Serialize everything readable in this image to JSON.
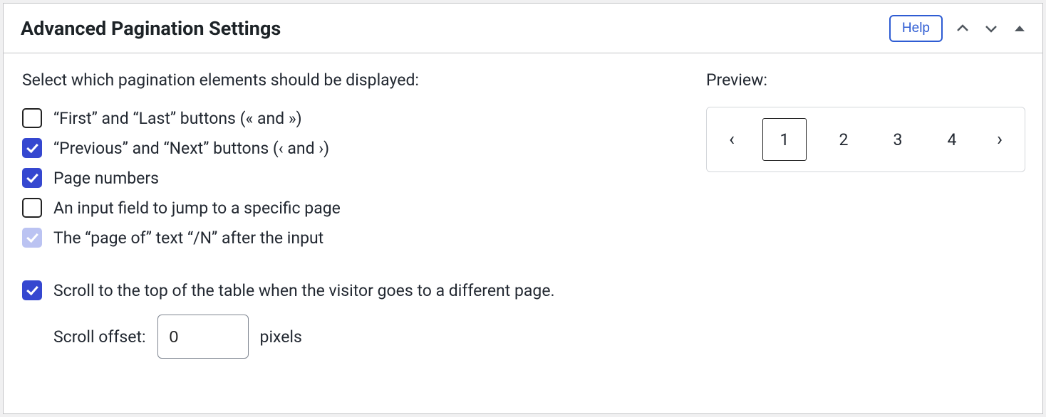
{
  "header": {
    "title": "Advanced Pagination Settings",
    "help_label": "Help"
  },
  "intro": "Select which pagination elements should be displayed:",
  "options": [
    {
      "label": "“First” and “Last” buttons (« and »)",
      "checked": false,
      "disabled": false
    },
    {
      "label": "“Previous” and “Next” buttons (‹ and ›)",
      "checked": true,
      "disabled": false
    },
    {
      "label": "Page numbers",
      "checked": true,
      "disabled": false
    },
    {
      "label": "An input field to jump to a specific page",
      "checked": false,
      "disabled": false
    },
    {
      "label": "The “page of” text “/N” after the input",
      "checked": true,
      "disabled": true
    }
  ],
  "scroll_option": {
    "label": "Scroll to the top of the table when the visitor goes to a different page.",
    "checked": true
  },
  "scroll_offset": {
    "label": "Scroll offset:",
    "value": "0",
    "unit": "pixels"
  },
  "preview": {
    "label": "Preview:",
    "prev": "‹",
    "next": "›",
    "pages": [
      "1",
      "2",
      "3",
      "4"
    ],
    "active_index": 0
  }
}
